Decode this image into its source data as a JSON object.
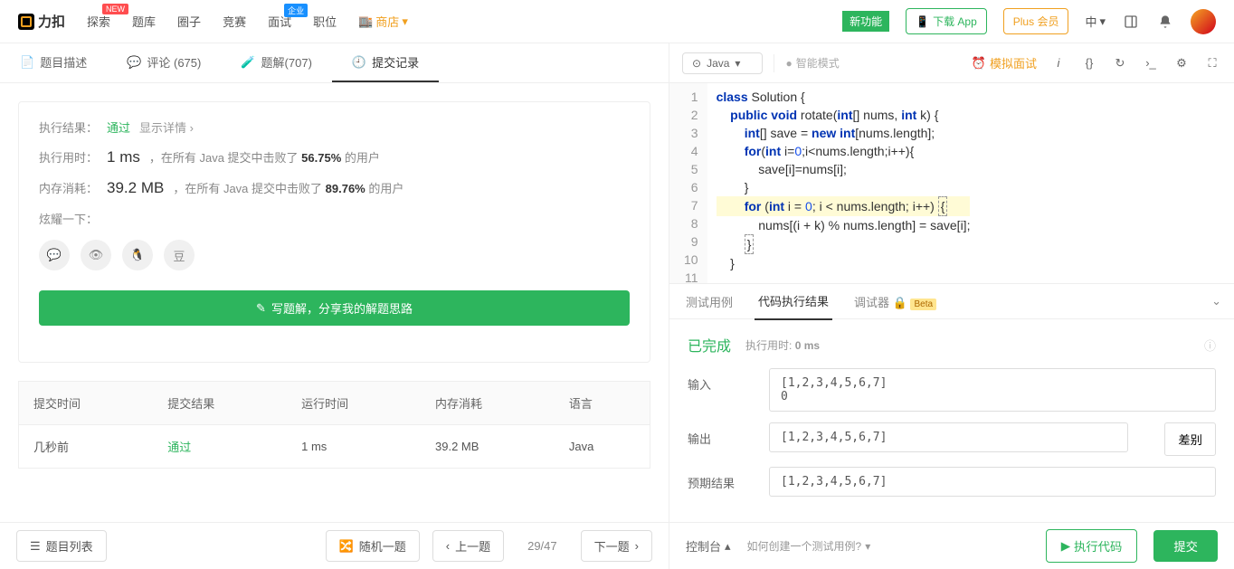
{
  "topnav": {
    "brand": "力扣",
    "items": [
      "探索",
      "题库",
      "圈子",
      "竞赛",
      "面试",
      "职位",
      "商店"
    ],
    "new_badge": "NEW",
    "biz_badge": "企业",
    "new_feature": "新功能",
    "download": "下载 App",
    "plus": "Plus 会员",
    "lang_switch": "中"
  },
  "left": {
    "tabs": {
      "desc": "题目描述",
      "comment": "评论 (675)",
      "solution": "题解(707)",
      "submit": "提交记录"
    },
    "result": {
      "exec_label": "执行结果：",
      "pass": "通过",
      "detail": "显示详情 ›",
      "time_label": "执行用时：",
      "time": "1 ms",
      "time_text1": "，在所有 Java 提交中击败了",
      "time_pct": "56.75%",
      "time_text2": " 的用户",
      "mem_label": "内存消耗：",
      "mem": "39.2 MB",
      "mem_text1": "，在所有 Java 提交中击败了",
      "mem_pct": "89.76%",
      "mem_text2": " 的用户",
      "brag": "炫耀一下："
    },
    "share_btn": "写题解，分享我的解题思路",
    "table": {
      "headers": [
        "提交时间",
        "提交结果",
        "运行时间",
        "内存消耗",
        "语言"
      ],
      "row": [
        "几秒前",
        "通过",
        "1 ms",
        "39.2 MB",
        "Java"
      ]
    },
    "bottom": {
      "list": "题目列表",
      "random": "随机一题",
      "prev": "上一题",
      "page": "29/47",
      "next": "下一题"
    }
  },
  "right": {
    "lang": "Java",
    "smart": "智能模式",
    "mock": "模拟面试",
    "code_lines": [
      "class Solution {",
      "    public void rotate(int[] nums, int k) {",
      "        int[] save = new int[nums.length];",
      "        for(int i=0;i<nums.length;i++){",
      "            save[i]=nums[i];",
      "        }",
      "        for (int i = 0; i < nums.length; i++) {",
      "            nums[(i + k) % nums.length] = save[i];",
      "        }",
      "    }",
      "",
      "}"
    ],
    "result_tabs": {
      "test": "测试用例",
      "exec": "代码执行结果",
      "debug": "调试器",
      "beta": "Beta"
    },
    "status": {
      "done": "已完成",
      "runtime_label": "执行用时:",
      "runtime": "0 ms"
    },
    "io": {
      "input_label": "输入",
      "input": "[1,2,3,4,5,6,7]\n0",
      "output_label": "输出",
      "output": "[1,2,3,4,5,6,7]",
      "expected_label": "预期结果",
      "expected": "[1,2,3,4,5,6,7]",
      "diff": "差别"
    },
    "bottom": {
      "console": "控制台",
      "help": "如何创建一个测试用例?",
      "run": "执行代码",
      "submit": "提交"
    }
  }
}
